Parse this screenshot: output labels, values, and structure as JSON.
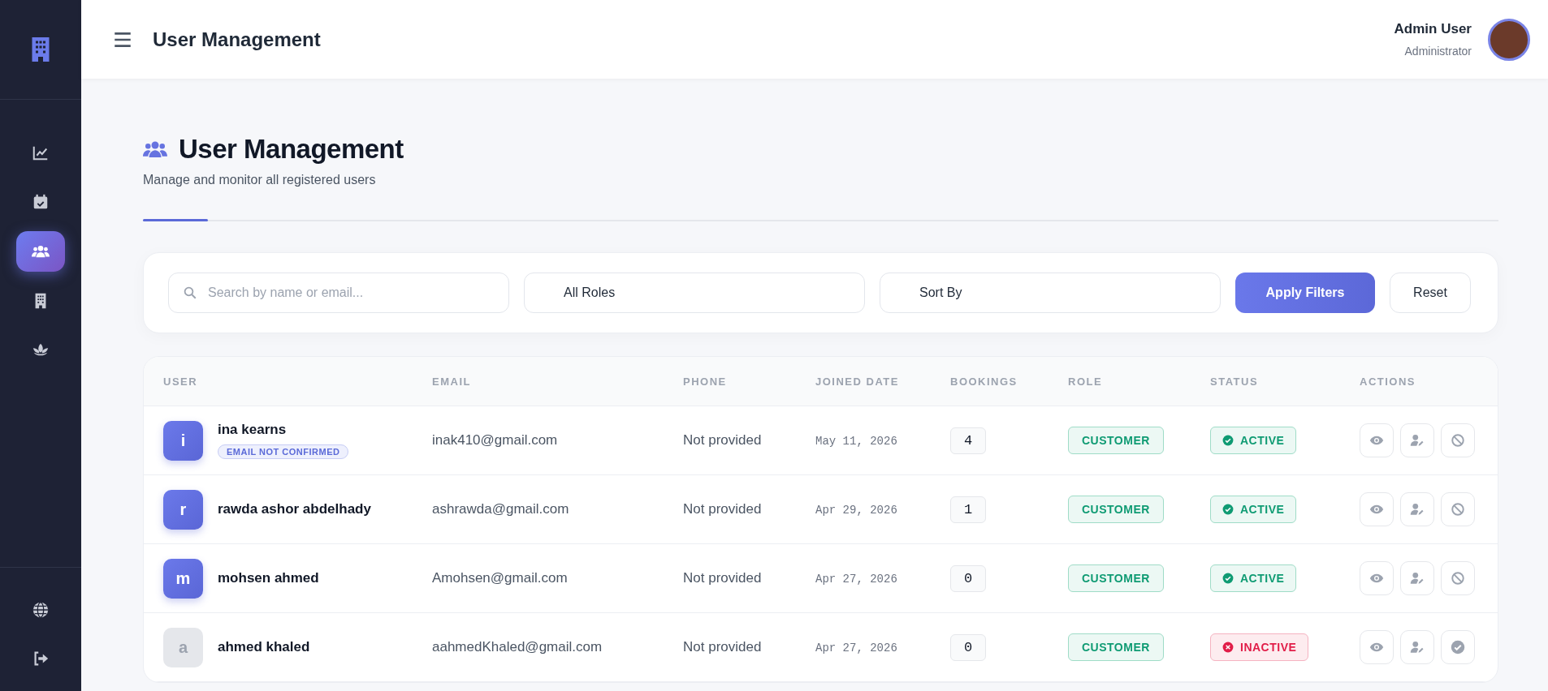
{
  "sidebar": {
    "items": [
      {
        "selected": false
      },
      {
        "selected": false
      },
      {
        "selected": true
      },
      {
        "selected": false
      },
      {
        "selected": false
      }
    ]
  },
  "header": {
    "title": "User Management",
    "user": {
      "name": "Admin User",
      "role": "Administrator"
    }
  },
  "page": {
    "title": "User Management",
    "subtitle": "Manage and monitor all registered users"
  },
  "filters": {
    "search": {
      "placeholder": "Search by name or email..."
    },
    "role_select": "All Roles",
    "sort_select": "Sort By",
    "buttons": [
      {
        "label": "Apply Filters",
        "kind": "primary"
      },
      {
        "label": "Reset",
        "kind": "secondary"
      }
    ]
  },
  "table": {
    "columns": [
      "USER",
      "EMAIL",
      "PHONE",
      "JOINED DATE",
      "BOOKINGS",
      "ROLE",
      "STATUS",
      "ACTIONS"
    ],
    "rows": [
      {
        "initial": "i",
        "name": "ina kearns",
        "badge": "EMAIL NOT CONFIRMED",
        "email": "inak410@gmail.com",
        "phone": "Not provided",
        "joined": "May 11, 2026",
        "bookings": "4",
        "role": "CUSTOMER",
        "status": "ACTIVE",
        "active": true
      },
      {
        "initial": "r",
        "name": "rawda ashor abdelhady",
        "email": "ashrawda@gmail.com",
        "phone": "Not provided",
        "joined": "Apr 29, 2026",
        "bookings": "1",
        "role": "CUSTOMER",
        "status": "ACTIVE",
        "active": true
      },
      {
        "initial": "m",
        "name": "mohsen ahmed",
        "email": "Amohsen@gmail.com",
        "phone": "Not provided",
        "joined": "Apr 27, 2026",
        "bookings": "0",
        "role": "CUSTOMER",
        "status": "ACTIVE",
        "active": true
      },
      {
        "initial": "a",
        "name": "ahmed khaled",
        "email": "aahmedKhaled@gmail.com",
        "phone": "Not provided",
        "joined": "Apr 27, 2026",
        "bookings": "0",
        "role": "CUSTOMER",
        "status": "INACTIVE",
        "active": false
      }
    ]
  }
}
